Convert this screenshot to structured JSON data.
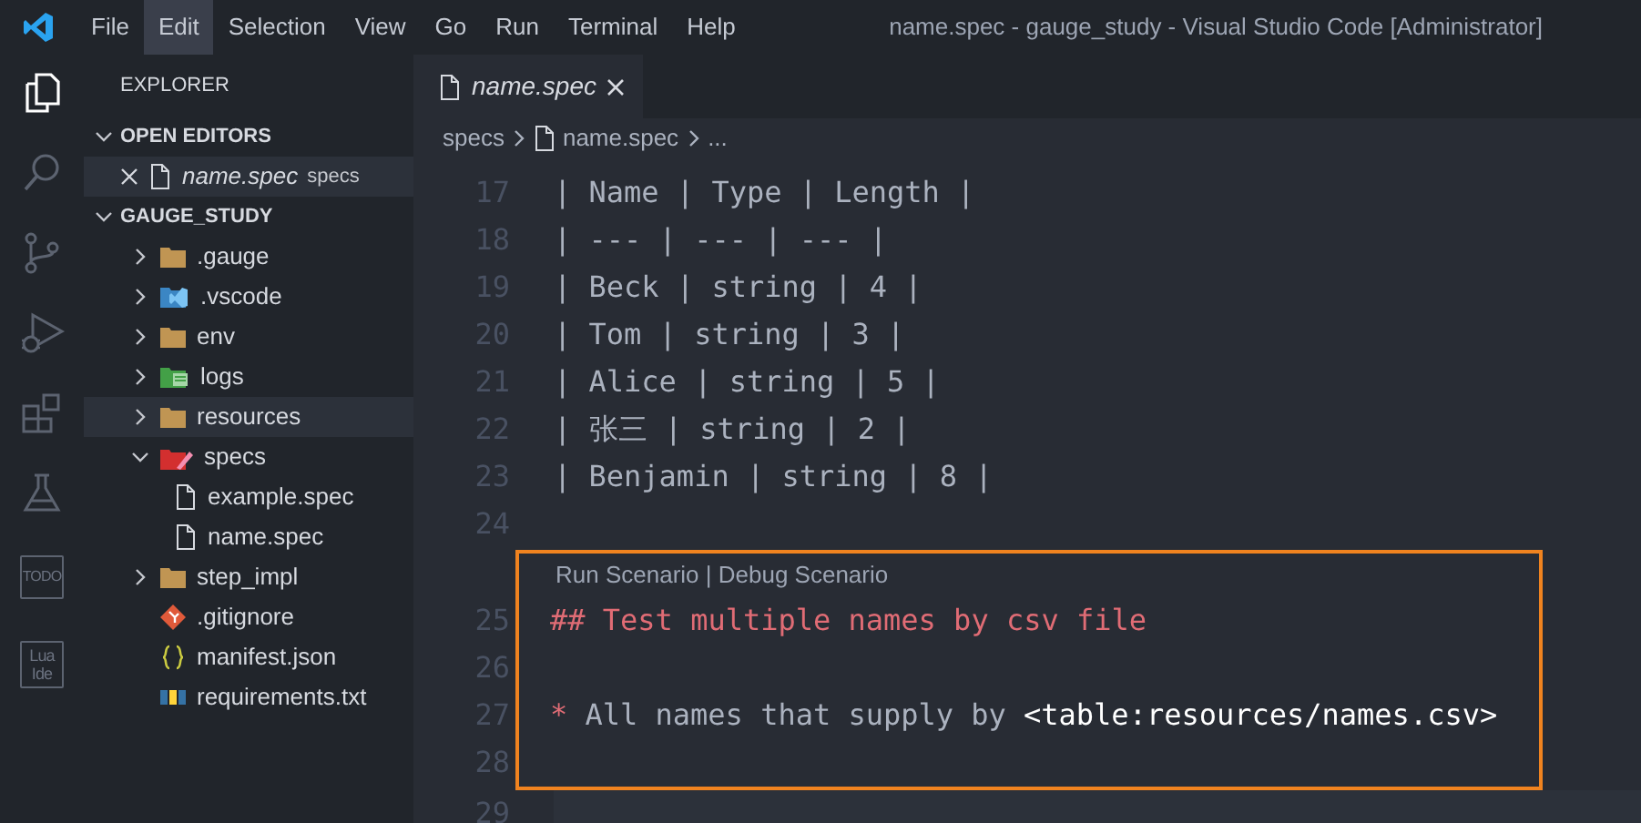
{
  "menu": [
    {
      "label": "File",
      "selected": false
    },
    {
      "label": "Edit",
      "selected": true
    },
    {
      "label": "Selection",
      "selected": false
    },
    {
      "label": "View",
      "selected": false
    },
    {
      "label": "Go",
      "selected": false
    },
    {
      "label": "Run",
      "selected": false
    },
    {
      "label": "Terminal",
      "selected": false
    },
    {
      "label": "Help",
      "selected": false
    }
  ],
  "window": {
    "title": "name.spec - gauge_study - Visual Studio Code [Administrator]"
  },
  "activity_bar": [
    {
      "kind": "explorer",
      "selected": true
    },
    {
      "kind": "search",
      "selected": false
    },
    {
      "kind": "source-control",
      "selected": false
    },
    {
      "kind": "debug",
      "selected": false
    },
    {
      "kind": "extensions",
      "selected": false
    },
    {
      "kind": "flask",
      "selected": false
    },
    {
      "kind": "todo",
      "label": "TODO",
      "selected": false
    },
    {
      "kind": "lua",
      "label": "Lua Ide",
      "selected": false
    }
  ],
  "sidebar": {
    "title": "EXPLORER",
    "open_editors": {
      "title": "OPEN EDITORS",
      "expanded": true,
      "items": [
        {
          "name": "name.spec",
          "folder": "specs"
        }
      ]
    },
    "project": {
      "title": "GAUGE_STUDY",
      "expanded": true,
      "items": [
        {
          "name": ".gauge",
          "kind": "folder",
          "expanded": false,
          "selected": false
        },
        {
          "name": ".vscode",
          "kind": "vscode",
          "expanded": false,
          "selected": false
        },
        {
          "name": "env",
          "kind": "folder",
          "expanded": false,
          "selected": false
        },
        {
          "name": "logs",
          "kind": "logs",
          "expanded": false,
          "selected": false
        },
        {
          "name": "resources",
          "kind": "folder",
          "expanded": false,
          "selected": true
        },
        {
          "name": "specs",
          "kind": "specs",
          "expanded": true,
          "selected": false,
          "children": [
            {
              "name": "example.spec",
              "kind": "file",
              "selected": false
            },
            {
              "name": "name.spec",
              "kind": "file",
              "selected": false
            }
          ]
        },
        {
          "name": "step_impl",
          "kind": "folder",
          "expanded": false,
          "selected": false
        },
        {
          "name": ".gitignore",
          "kind": "git",
          "selected": false
        },
        {
          "name": "manifest.json",
          "kind": "json",
          "selected": false
        },
        {
          "name": "requirements.txt",
          "kind": "pip",
          "selected": false
        }
      ]
    }
  },
  "tabs": [
    {
      "label": "name.spec",
      "selected": true
    }
  ],
  "breadcrumb": [
    "specs",
    "name.spec",
    "..."
  ],
  "editor": {
    "lines": [
      {
        "number": "17",
        "kind": "plain",
        "text": "| Name | Type | Length |"
      },
      {
        "number": "18",
        "kind": "plain",
        "text": "| --- | --- | --- |"
      },
      {
        "number": "19",
        "kind": "plain",
        "text": "| Beck | string | 4 |"
      },
      {
        "number": "20",
        "kind": "plain",
        "text": "| Tom | string | 3 |"
      },
      {
        "number": "21",
        "kind": "plain",
        "text": "| Alice | string | 5 |"
      },
      {
        "number": "22",
        "kind": "plain",
        "text": "| 张三 | string | 2 |"
      },
      {
        "number": "23",
        "kind": "plain",
        "text": "| Benjamin | string | 8 |"
      },
      {
        "number": "24",
        "kind": "plain"
      },
      {
        "kind": "codelens",
        "text": "Run Scenario | Debug Scenario"
      },
      {
        "number": "25",
        "kind": "heading",
        "text": "## Test multiple names by csv file"
      },
      {
        "number": "26",
        "kind": "plain"
      },
      {
        "number": "27",
        "kind": "step",
        "bullet": "*",
        "text": "All names that supply by",
        "param": "<table:resources/names.csv>"
      },
      {
        "number": "28",
        "kind": "plain"
      },
      {
        "number": "29",
        "kind": "current"
      }
    ]
  }
}
